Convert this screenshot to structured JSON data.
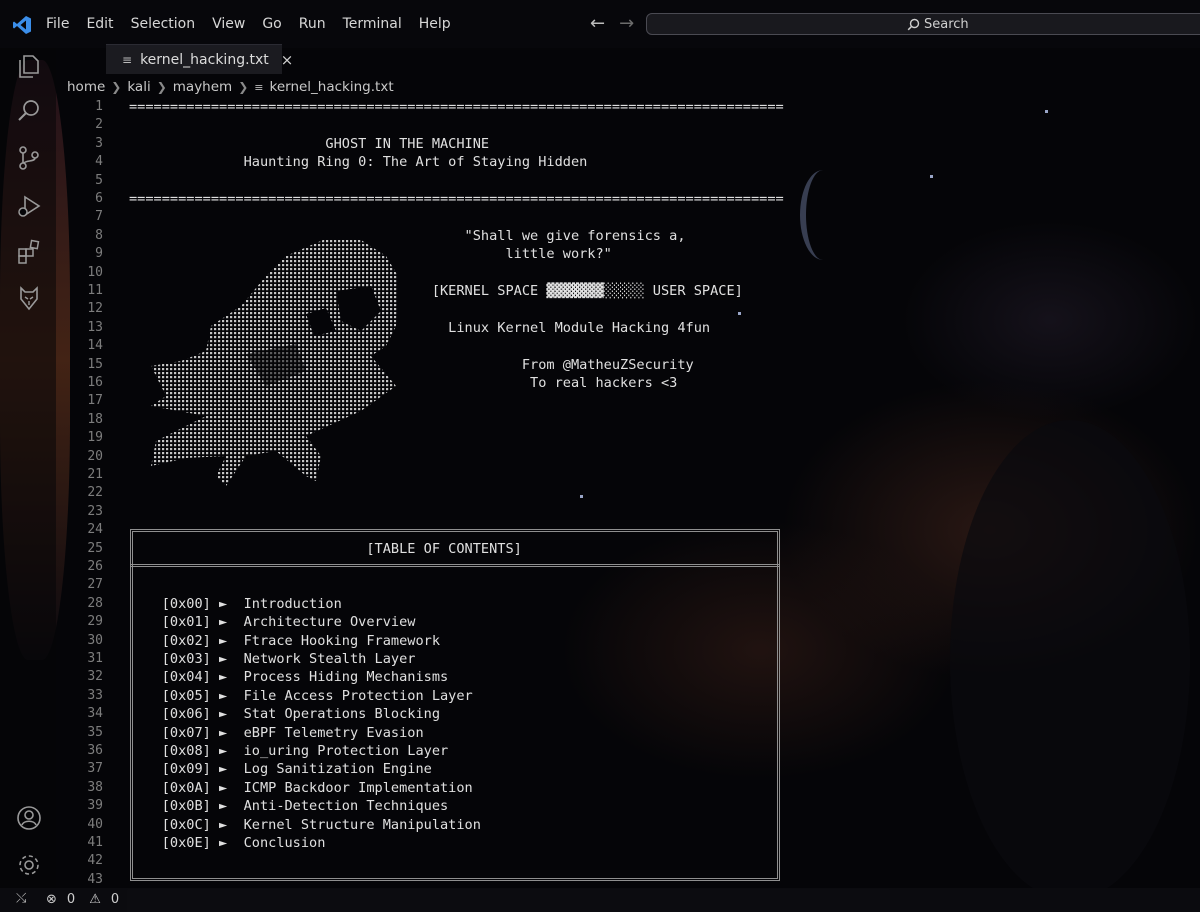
{
  "menu": [
    "File",
    "Edit",
    "Selection",
    "View",
    "Go",
    "Run",
    "Terminal",
    "Help"
  ],
  "search": {
    "label": "Search"
  },
  "tab": {
    "filename": "kernel_hacking.txt"
  },
  "breadcrumb": [
    "home",
    "kali",
    "mayhem",
    "kernel_hacking.txt"
  ],
  "lines": [
    {
      "n": "1",
      "text": "================================================================================"
    },
    {
      "n": "2",
      "text": ""
    },
    {
      "n": "3",
      "text": "                        GHOST IN THE MACHINE"
    },
    {
      "n": "4",
      "text": "              Haunting Ring 0: The Art of Staying Hidden"
    },
    {
      "n": "5",
      "text": ""
    },
    {
      "n": "6",
      "text": "================================================================================"
    },
    {
      "n": "7",
      "text": ""
    },
    {
      "n": "8",
      "text": "                                         \"Shall we give forensics a,"
    },
    {
      "n": "9",
      "text": "                                              little work?\""
    },
    {
      "n": "10",
      "text": ""
    },
    {
      "n": "11",
      "text": "                                     [KERNEL SPACE ▓▓▓▓▓▓▓░░░░░ USER SPACE]"
    },
    {
      "n": "12",
      "text": ""
    },
    {
      "n": "13",
      "text": "                                       Linux Kernel Module Hacking 4fun"
    },
    {
      "n": "14",
      "text": ""
    },
    {
      "n": "15",
      "text": "                                                From @MatheuZSecurity"
    },
    {
      "n": "16",
      "text": "                                                 To real hackers <3"
    },
    {
      "n": "17",
      "text": ""
    },
    {
      "n": "18",
      "text": ""
    },
    {
      "n": "19",
      "text": ""
    },
    {
      "n": "20",
      "text": ""
    },
    {
      "n": "21",
      "text": ""
    },
    {
      "n": "22",
      "text": ""
    },
    {
      "n": "23",
      "text": ""
    },
    {
      "n": "24",
      "text": ""
    },
    {
      "n": "25",
      "text": "                             [TABLE OF CONTENTS]"
    },
    {
      "n": "26",
      "text": ""
    },
    {
      "n": "27",
      "text": ""
    },
    {
      "n": "28",
      "text": "    [0x00] ►  Introduction"
    },
    {
      "n": "29",
      "text": "    [0x01] ►  Architecture Overview"
    },
    {
      "n": "30",
      "text": "    [0x02] ►  Ftrace Hooking Framework"
    },
    {
      "n": "31",
      "text": "    [0x03] ►  Network Stealth Layer"
    },
    {
      "n": "32",
      "text": "    [0x04] ►  Process Hiding Mechanisms"
    },
    {
      "n": "33",
      "text": "    [0x05] ►  File Access Protection Layer"
    },
    {
      "n": "34",
      "text": "    [0x06] ►  Stat Operations Blocking"
    },
    {
      "n": "35",
      "text": "    [0x07] ►  eBPF Telemetry Evasion"
    },
    {
      "n": "36",
      "text": "    [0x08] ►  io_uring Protection Layer"
    },
    {
      "n": "37",
      "text": "    [0x09] ►  Log Sanitization Engine"
    },
    {
      "n": "38",
      "text": "    [0x0A] ►  ICMP Backdoor Implementation"
    },
    {
      "n": "39",
      "text": "    [0x0B] ►  Anti-Detection Techniques"
    },
    {
      "n": "40",
      "text": "    [0x0C] ►  Kernel Structure Manipulation"
    },
    {
      "n": "41",
      "text": "    [0x0E] ►  Conclusion"
    },
    {
      "n": "42",
      "text": ""
    },
    {
      "n": "43",
      "text": ""
    }
  ],
  "status": {
    "errors": "0",
    "warnings": "0"
  },
  "icons": {
    "activity": [
      "explorer-icon",
      "search-icon",
      "source-control-icon",
      "run-debug-icon",
      "extensions-icon",
      "kali-dragon-icon"
    ],
    "bottom": [
      "account-icon",
      "settings-gear-icon"
    ]
  },
  "colors": {
    "accent": "#3b8eea"
  }
}
